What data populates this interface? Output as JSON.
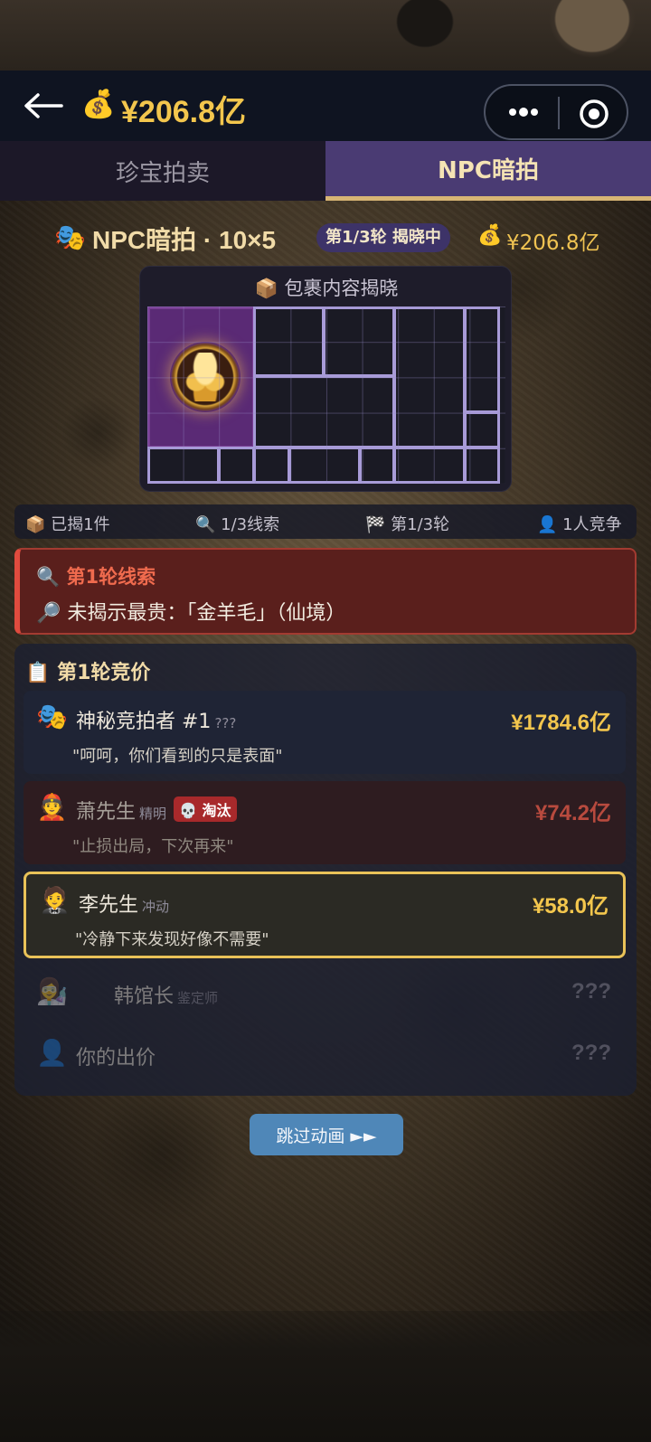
{
  "header": {
    "balance": "¥206.8亿",
    "money_icon": "💰"
  },
  "tabs": [
    {
      "label": "珍宝拍卖",
      "active": false
    },
    {
      "label": "NPC暗拍",
      "active": true
    }
  ],
  "title_row": {
    "icon": "🎭",
    "title": "NPC暗拍 · 10×5",
    "badge": "第1/3轮 揭晓中",
    "money_icon": "💰",
    "balance": "¥206.8亿"
  },
  "reveal": {
    "icon": "📦",
    "title": "包裹内容揭晓",
    "grid_cols": 10,
    "grid_rows": 5,
    "revealed_item": "golden-fleece"
  },
  "stats": {
    "revealed": {
      "icon": "📦",
      "text": "已揭1件"
    },
    "clues": {
      "icon": "🔍",
      "text": "1/3线索"
    },
    "round": {
      "icon": "🏁",
      "text": "第1/3轮"
    },
    "competitors": {
      "icon": "👤",
      "text": "1人竞争"
    }
  },
  "clue": {
    "title_icon": "🔍",
    "title": "第1轮线索",
    "text_icon": "🔎",
    "text": "未揭示最贵：「金羊毛」（仙境）"
  },
  "bids": {
    "header_icon": "📋",
    "header": "第1轮竞价",
    "rows": [
      {
        "avatar": "🎭",
        "name": "神秘竞拍者 #1",
        "role": "???",
        "amount": "¥1784.6亿",
        "quote": "\"呵呵，你们看到的只是表面\""
      },
      {
        "avatar": "👲",
        "name": "萧先生",
        "role": "精明",
        "badge_icon": "💀",
        "badge": "淘汰",
        "amount": "¥74.2亿",
        "quote": "\"止损出局，下次再来\""
      },
      {
        "avatar": "🤵",
        "name": "李先生",
        "role": "冲动",
        "amount": "¥58.0亿",
        "quote": "\"冷静下来发现好像不需要\""
      },
      {
        "avatar": "👩‍🔬",
        "name": "韩馆长",
        "role": "鉴定师",
        "amount": "???"
      },
      {
        "avatar": "👤",
        "name": "你的出价",
        "amount": "???"
      }
    ]
  },
  "skip_button": "跳过动画 ►►",
  "colors": {
    "gold": "#f3c64d",
    "tab_active": "#4a3b73",
    "clue_red": "#e04b3e",
    "skip_blue": "#4f87b8"
  }
}
